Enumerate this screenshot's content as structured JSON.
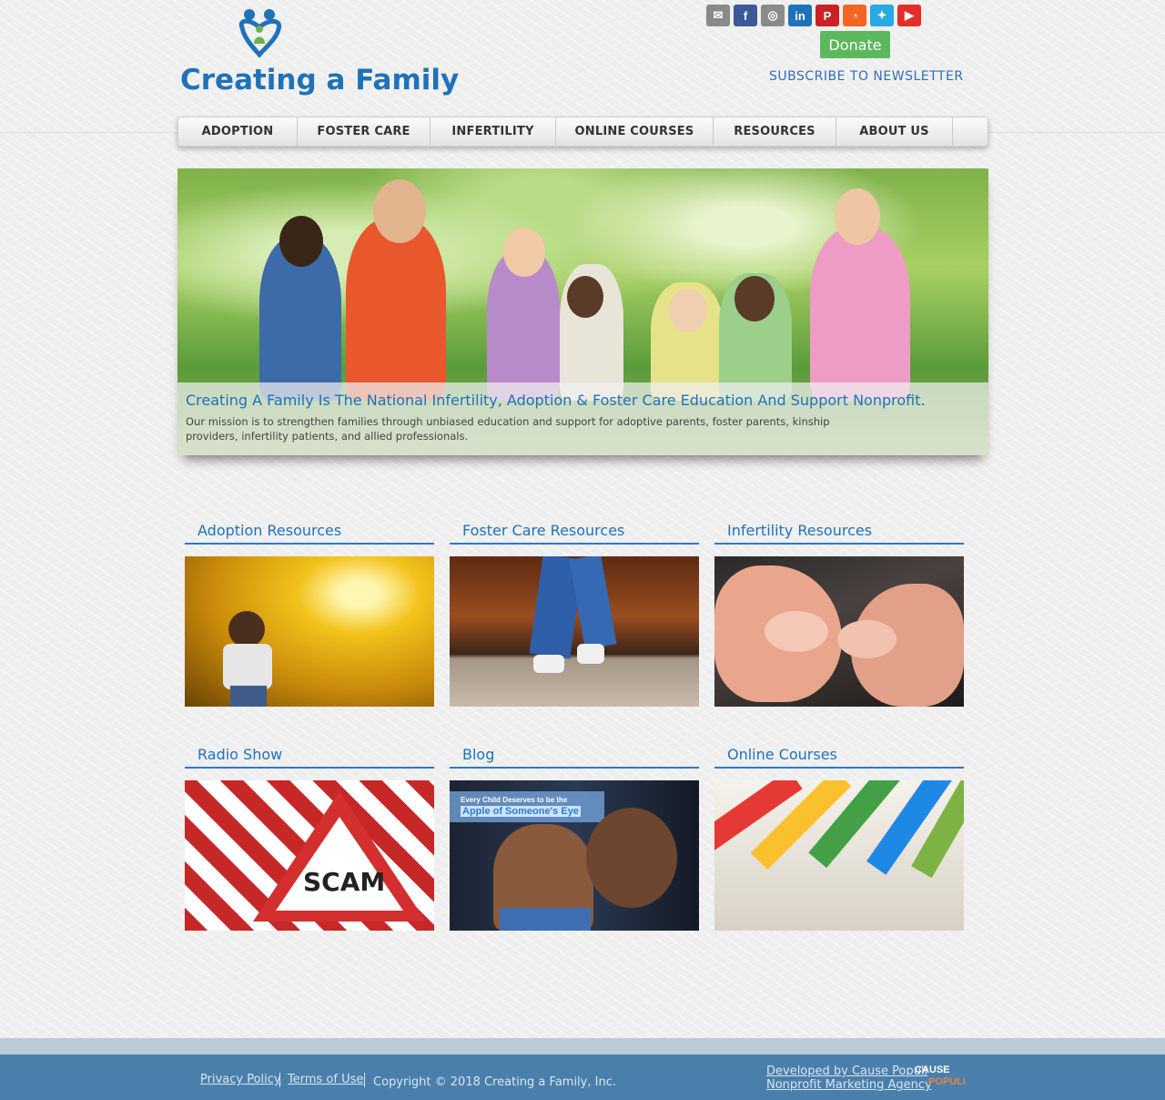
{
  "logo": {
    "text": "Creating a Family"
  },
  "social": [
    {
      "icon": "email-icon",
      "glyph": "✉",
      "color": "#8a8a8a"
    },
    {
      "icon": "facebook-icon",
      "glyph": "f",
      "color": "#3b5998"
    },
    {
      "icon": "instagram-icon",
      "glyph": "◎",
      "color": "#8a8a8a"
    },
    {
      "icon": "linkedin-icon",
      "glyph": "in",
      "color": "#1f72b8"
    },
    {
      "icon": "pinterest-icon",
      "glyph": "P",
      "color": "#cb2027"
    },
    {
      "icon": "rss-icon",
      "glyph": "◔",
      "color": "#f26522"
    },
    {
      "icon": "twitter-icon",
      "glyph": "✦",
      "color": "#29a9e1"
    },
    {
      "icon": "youtube-icon",
      "glyph": "▶",
      "color": "#e52d27"
    }
  ],
  "header": {
    "donate_label": "Donate",
    "subscribe_label": "SUBSCRIBE TO NEWSLETTER"
  },
  "nav": [
    "ADOPTION",
    "FOSTER CARE",
    "INFERTILITY",
    "ONLINE COURSES",
    "RESOURCES",
    "ABOUT US"
  ],
  "hero": {
    "title": "Creating A Family Is The National Infertility, Adoption & Foster Care Education And Support Nonprofit.",
    "text": "Our mission is to strengthen families through unbiased education and support for adoptive parents, foster parents, kinship providers, infertility patients, and allied professionals."
  },
  "cards": [
    {
      "title": "Adoption Resources"
    },
    {
      "title": "Foster Care Resources"
    },
    {
      "title": "Infertility Resources"
    },
    {
      "title": "Radio Show"
    },
    {
      "title": "Blog"
    },
    {
      "title": "Online Courses"
    }
  ],
  "card_images": {
    "scam_label": "SCAM",
    "blog_line1": "Every Child Deserves to be the",
    "blog_line2": "Apple of Someone's Eye"
  },
  "footer": {
    "privacy": "Privacy Policy",
    "terms": "Terms of Use",
    "copyright": "Copyright © 2018 Creating a Family, Inc.",
    "developed_line1": "Developed by Cause Populi",
    "developed_line2": "Nonprofit Marketing Agency",
    "agency_logo_1": "CAUSE",
    "agency_logo_2": "POPULI"
  },
  "colors": {
    "brand_blue": "#1f72b8",
    "donate_green": "#5cb85c",
    "footer_blue": "#4a7fab"
  }
}
